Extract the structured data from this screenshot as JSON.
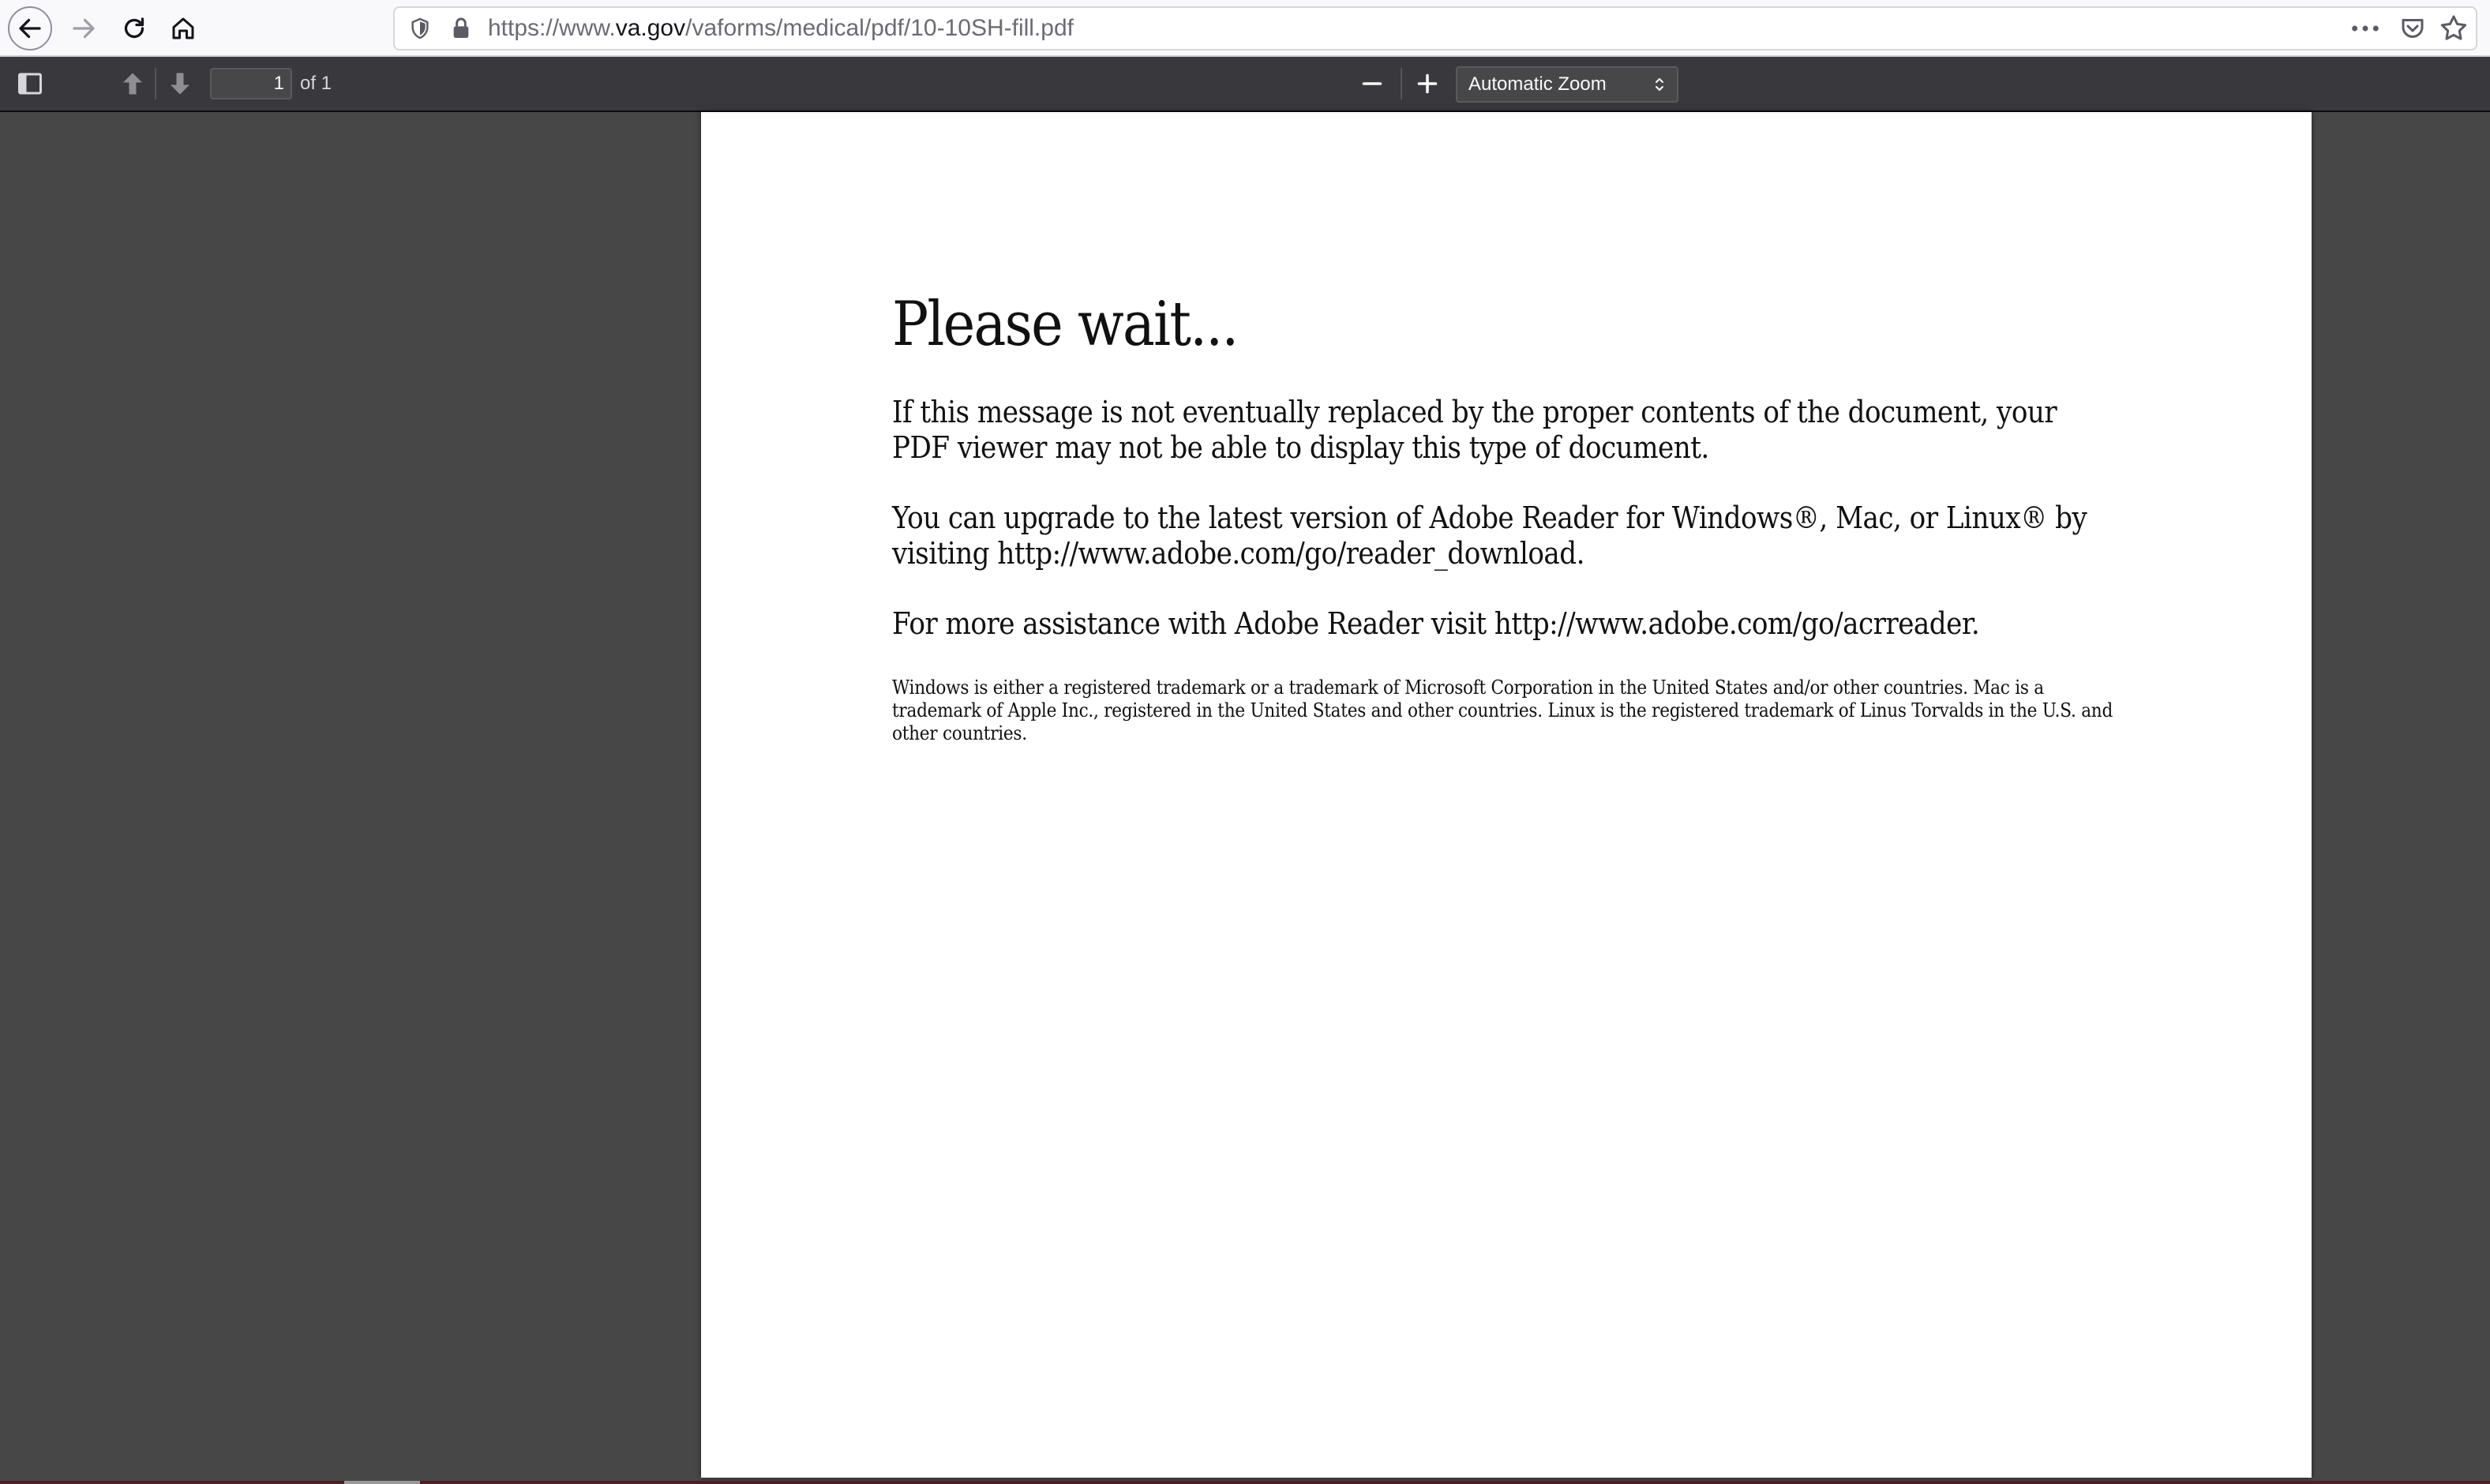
{
  "browser": {
    "url_prefix": "https://www.",
    "url_host": "va.gov",
    "url_path": "/vaforms/medical/pdf/10-10SH-fill.pdf"
  },
  "pdf_toolbar": {
    "page_number": "1",
    "page_count": "of 1",
    "zoom_value": "Automatic Zoom"
  },
  "document": {
    "heading": "Please wait...",
    "paragraph_1": "If this message is not eventually replaced by the proper contents of the document, your PDF viewer may not be able to display this type of document.",
    "paragraph_2": "You can upgrade to the latest version of Adobe Reader for Windows®, Mac, or Linux® by visiting  http://www.adobe.com/go/reader_download.",
    "paragraph_3": "For more assistance with Adobe Reader visit  http://www.adobe.com/go/acrreader.",
    "trademark_note": "Windows is either a registered trademark or a trademark of Microsoft Corporation in the United States and/or other countries. Mac is a trademark of Apple Inc., registered in the United States and other countries. Linux is the registered trademark of Linus Torvalds in the U.S. and other countries."
  },
  "icons": {
    "back": "back-arrow-icon",
    "forward": "forward-arrow-icon",
    "reload": "reload-icon",
    "home": "home-icon",
    "shield": "tracking-protection-shield-icon",
    "lock": "lock-icon",
    "more": "more-ellipsis-icon",
    "pocket": "pocket-icon",
    "star": "bookmark-star-icon",
    "sidebar": "sidebar-toggle-icon",
    "prev": "previous-page-icon",
    "next": "next-page-icon",
    "zoom_out": "zoom-out-icon",
    "zoom_in": "zoom-in-icon"
  },
  "colors": {
    "browser_bar": "#f9f9fb",
    "pdf_toolbar": "#38383d",
    "viewer_background": "#474747",
    "page": "#ffffff"
  }
}
